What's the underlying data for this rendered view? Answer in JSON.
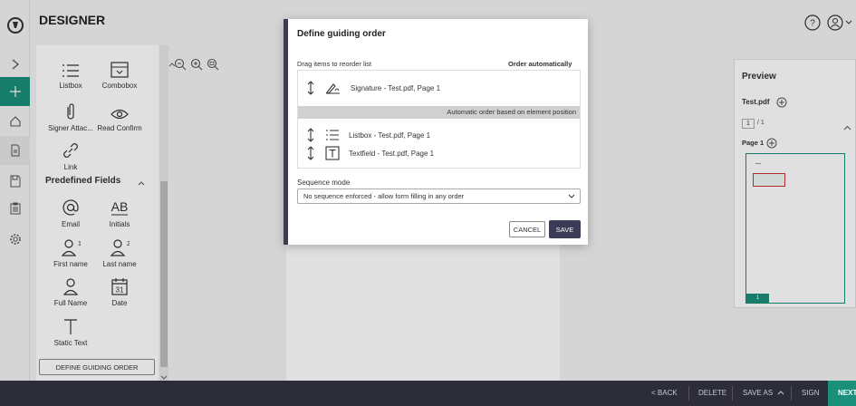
{
  "header": {
    "title": "DESIGNER"
  },
  "rail": {
    "items": [
      "expand-icon",
      "add-icon",
      "home-icon",
      "document-icon",
      "save-icon",
      "clipboard-icon",
      "settings-icon"
    ]
  },
  "fields": {
    "listbox": "Listbox",
    "combobox": "Combobox",
    "signer_attachment": "Signer Attac...",
    "read_confirm": "Read Confirm",
    "link": "Link",
    "predefined_title": "Predefined Fields",
    "email": "Email",
    "initials": "Initials",
    "first_name": "First name",
    "last_name": "Last name",
    "full_name": "Full Name",
    "date": "Date",
    "static_text": "Static Text",
    "define_button": "DEFINE GUIDING ORDER"
  },
  "preview": {
    "title": "Preview",
    "file": "Test.pdf",
    "page_input": "1",
    "page_total": "/ 1",
    "page_label": "Page 1",
    "thumb_num": "1"
  },
  "modal": {
    "title": "Define guiding order",
    "drag_label": "Drag items to reorder list",
    "order_auto": "Order automatically",
    "item_signature": "Signature - Test.pdf, Page 1",
    "auto_order_bar": "Automatic order based on element position",
    "item_listbox": "Listbox - Test.pdf, Page 1",
    "item_textfield": "Textfield - Test.pdf, Page 1",
    "sequence_label": "Sequence mode",
    "sequence_value": "No sequence enforced - allow form filling in any order",
    "cancel": "CANCEL",
    "save": "SAVE"
  },
  "bottom": {
    "back": "< BACK",
    "delete": "DELETE",
    "save_as": "SAVE AS",
    "sign": "SIGN",
    "next": "NEXT"
  },
  "colors": {
    "accent": "#1a8f7a",
    "dark": "#2d2d3a",
    "modal_border": "#3b3b55"
  }
}
